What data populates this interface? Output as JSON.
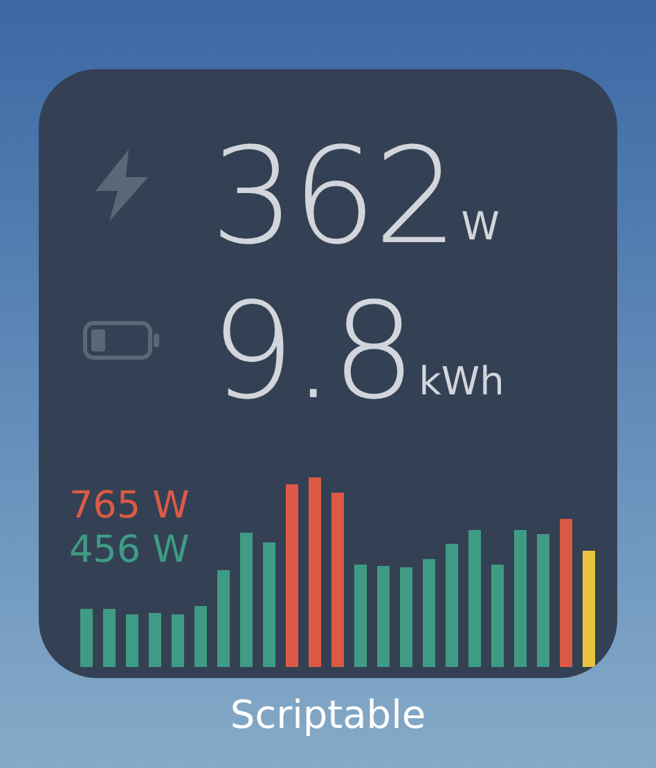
{
  "widget": {
    "readings": [
      {
        "kind": "power",
        "value": "362",
        "unit": "W"
      },
      {
        "kind": "energy",
        "value": "9.8",
        "unit": "kWh"
      }
    ],
    "chart": {
      "peak_label": "765 W",
      "average_label": "456 W"
    }
  },
  "app_label": "Scriptable"
}
